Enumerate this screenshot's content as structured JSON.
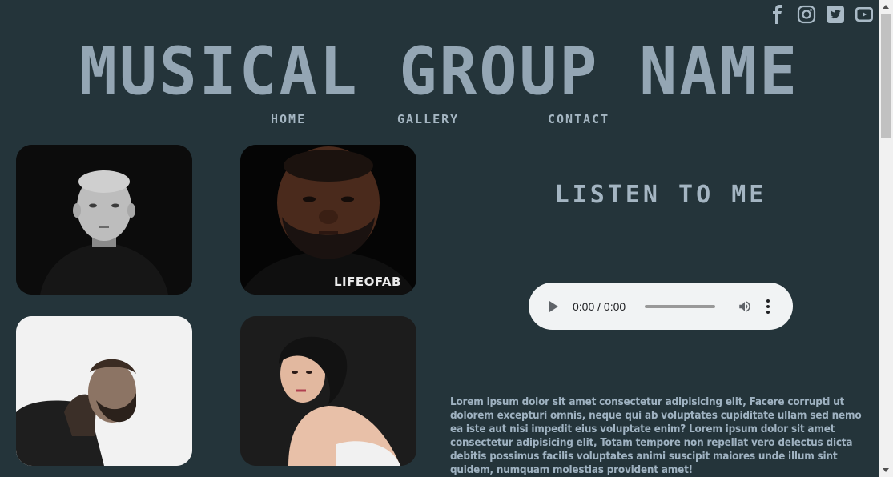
{
  "header": {
    "title": "MUSICAL GROUP NAME"
  },
  "social": [
    {
      "icon": "facebook-icon"
    },
    {
      "icon": "instagram-icon"
    },
    {
      "icon": "twitter-icon"
    },
    {
      "icon": "youtube-icon"
    }
  ],
  "nav": {
    "home": "HOME",
    "gallery": "GALLERY",
    "contact": "CONTACT"
  },
  "gallery": {
    "photo2_caption": "LIFEOFAB"
  },
  "listen": {
    "heading": "LISTEN TO ME"
  },
  "player": {
    "time": "0:00 / 0:00"
  },
  "about": {
    "text": "Lorem ipsum dolor sit amet consectetur adipisicing elit, Facere corrupti ut dolorem excepturi omnis, neque qui ab voluptates cupiditate ullam sed nemo ea iste aut nisi impedit eius voluptate enim? Lorem ipsum dolor sit amet consectetur adipisicing elit, Totam tempore non repellat vero delectus dicta debitis possimus facilis voluptates animi suscipit maiores unde illum sint quidem, numquam molestias provident amet!"
  },
  "colors": {
    "background": "#24343a",
    "title": "#94a6b4",
    "text": "#9fb2c1",
    "player": "#f1f3f4"
  }
}
